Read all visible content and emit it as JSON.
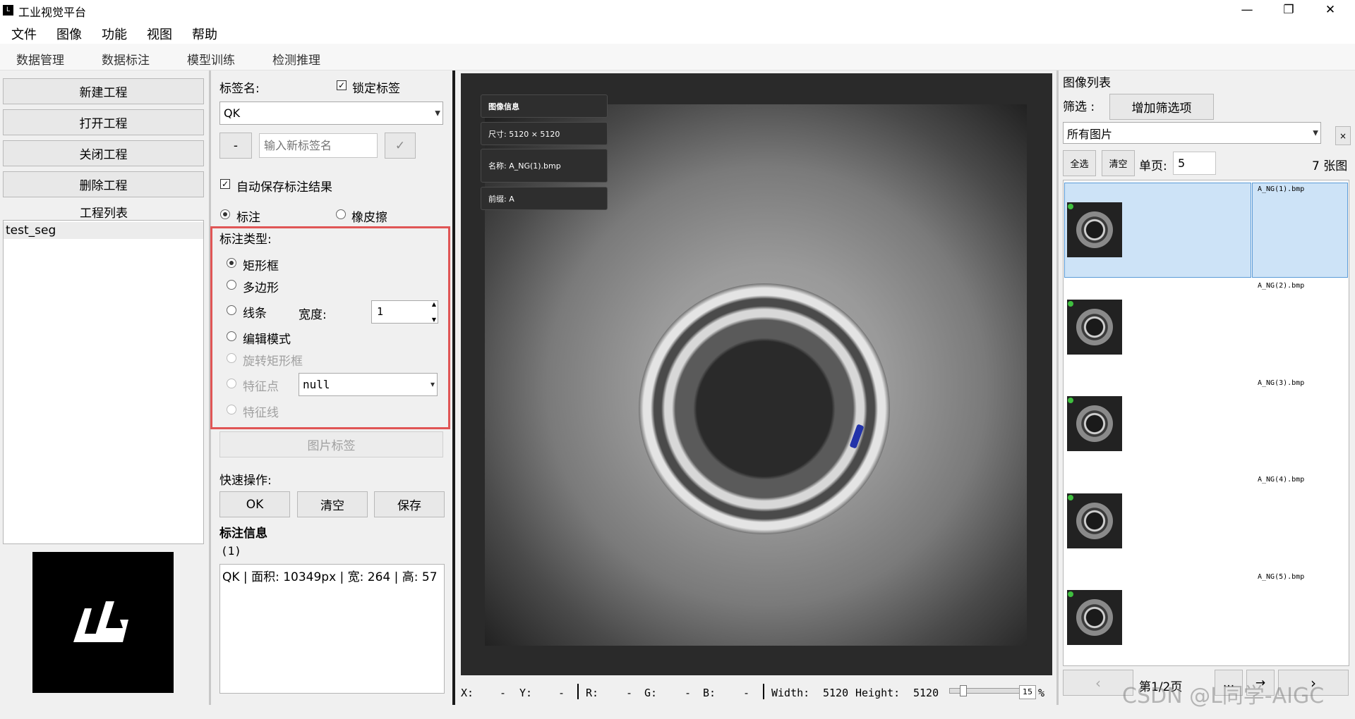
{
  "app": {
    "title": "工业视觉平台",
    "icon": "app-logo-icon"
  },
  "window": {
    "minimize": "—",
    "restore": "❐",
    "close": "✕"
  },
  "menu": [
    "文件",
    "图像",
    "功能",
    "视图",
    "帮助"
  ],
  "tabs": [
    "数据管理",
    "数据标注",
    "模型训练",
    "检测推理"
  ],
  "project": {
    "buttons": [
      "新建工程",
      "打开工程",
      "关闭工程",
      "删除工程"
    ],
    "list_header": "工程列表",
    "items": [
      "test_seg"
    ]
  },
  "annotation": {
    "label_name": "标签名:",
    "lock_label": "锁定标签",
    "label_value": "QK",
    "minus": "-",
    "new_label_placeholder": "输入新标签名",
    "confirm": "✓",
    "auto_save": "自动保存标注结果",
    "mode_annotate": "标注",
    "mode_eraser": "橡皮擦",
    "type_header": "标注类型:",
    "types": {
      "rect": "矩形框",
      "polygon": "多边形",
      "line": "线条",
      "width_label": "宽度:",
      "width_value": "1",
      "edit": "编辑模式",
      "rotated_rect": "旋转矩形框",
      "keypoint": "特征点",
      "keypoint_value": "null",
      "feature_line": "特征线"
    },
    "image_label_button": "图片标签",
    "quick_ops": "快速操作:",
    "quick_buttons": [
      "OK",
      "清空",
      "保存"
    ],
    "info_header": "标注信息",
    "info_count": "(1)",
    "info_entry": "QK | 面积: 10349px | 宽: 264 | 高: 57"
  },
  "viewer": {
    "info_title": "图像信息",
    "size": "尺寸: 5120 × 5120",
    "name": "名称: A_NG(1).bmp",
    "prefix": "前缀: A"
  },
  "status": {
    "x": "X:",
    "x_val": "-",
    "y": "Y:",
    "y_val": "-",
    "r": "R:",
    "r_val": "-",
    "g": "G:",
    "g_val": "-",
    "b": "B:",
    "b_val": "-",
    "width_label": "Width:",
    "width_val": "5120",
    "height_label": "Height:",
    "height_val": "5120",
    "zoom": "15",
    "zoom_unit": "%",
    "zoom_fraction": 0.15
  },
  "image_list": {
    "title": "图像列表",
    "filter_label": "筛选 :",
    "add_filter": "增加筛选项",
    "filter_value": "所有图片",
    "filter_close": "×",
    "select_all": "全选",
    "clear": "清空",
    "per_page_label": "单页:",
    "per_page_value": "5",
    "count": "7 张图",
    "files": [
      "A_NG(1).bmp",
      "A_NG(2).bmp",
      "A_NG(3).bmp",
      "A_NG(4).bmp",
      "A_NG(5).bmp"
    ],
    "prev": "‹",
    "page": "第1/2页",
    "more": "...",
    "go": "→",
    "next": "›"
  },
  "watermark": "CSDN @L同学-AIGC"
}
